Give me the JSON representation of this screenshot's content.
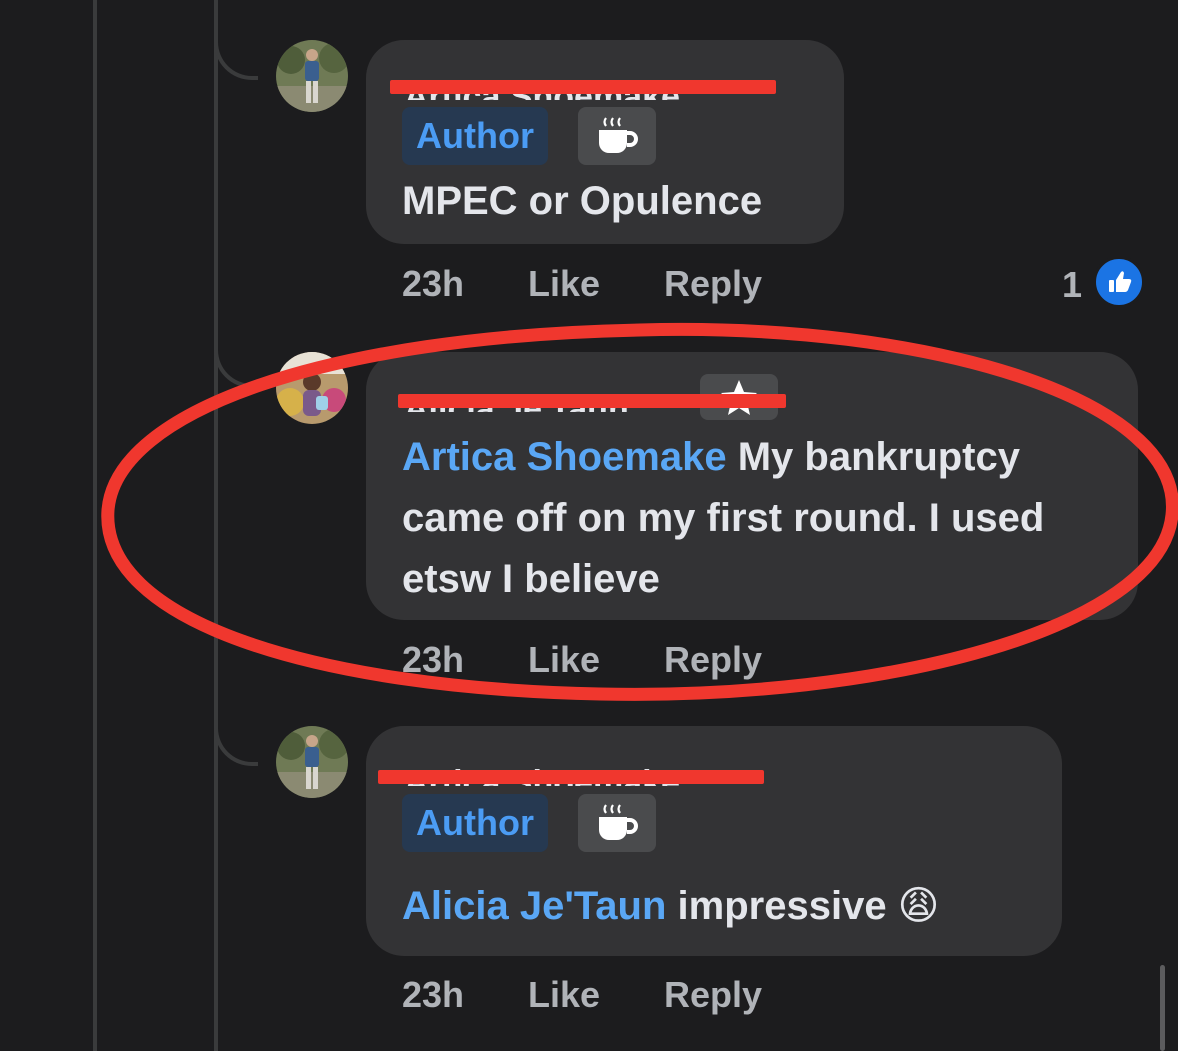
{
  "comments": [
    {
      "author_name": "Artica Shoemake",
      "author_badge": "Author",
      "badge_icon": "coffee-cup-icon",
      "text": "MPEC or Opulence",
      "time": "23h",
      "like_label": "Like",
      "reply_label": "Reply",
      "reaction_count": "1",
      "reaction_icon": "thumbs-up-icon"
    },
    {
      "author_name": "Alicia Je'Taun",
      "badge_icon": "star-icon",
      "mention": "Artica Shoemake",
      "text": " My bankruptcy came off on my first round. I used etsw I believe",
      "time": "23h",
      "like_label": "Like",
      "reply_label": "Reply"
    },
    {
      "author_name": "Artica Shoemake",
      "author_badge": "Author",
      "badge_icon": "coffee-cup-icon",
      "mention": "Alicia Je'Taun",
      "text": " impressive ",
      "emoji": "😩",
      "time": "23h",
      "like_label": "Like",
      "reply_label": "Reply"
    }
  ],
  "colors": {
    "background": "#1c1c1e",
    "bubble": "#333335",
    "mention": "#5aa7f5",
    "author_badge_bg": "#263951",
    "redaction_red": "#f0372e",
    "like_blue": "#1b74e4"
  }
}
